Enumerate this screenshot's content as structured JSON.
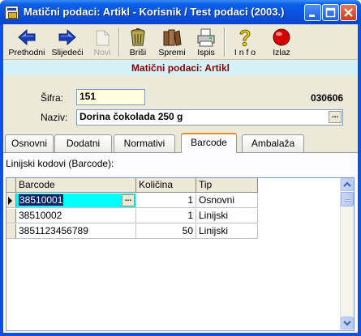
{
  "window": {
    "title": "Matični podaci: Artikl - Korisnik / Test podaci (2003.)"
  },
  "toolbar": {
    "items": [
      {
        "label": "Prethodni",
        "icon": "arrow-left-icon",
        "enabled": true
      },
      {
        "label": "Slijedeći",
        "icon": "arrow-right-icon",
        "enabled": true
      },
      {
        "label": "Novi",
        "icon": "new-document-icon",
        "enabled": false
      },
      {
        "label": "Briši",
        "icon": "trash-bin-icon",
        "enabled": true
      },
      {
        "label": "Spremi",
        "icon": "save-books-icon",
        "enabled": true
      },
      {
        "label": "Ispis",
        "icon": "printer-icon",
        "enabled": true
      },
      {
        "label": "I n f o",
        "icon": "help-question-icon",
        "enabled": true
      },
      {
        "label": "Izlaz",
        "icon": "exit-red-ball-icon",
        "enabled": true
      }
    ]
  },
  "header": {
    "title": "Matični podaci: Artikl"
  },
  "form": {
    "sifra_label": "Šifra:",
    "sifra_value": "151",
    "naziv_label": "Naziv:",
    "naziv_value": "Dorina čokolada 250 g",
    "code": "030606"
  },
  "tabs": [
    {
      "label": "Osnovni",
      "active": false
    },
    {
      "label": "Dodatni",
      "active": false
    },
    {
      "label": "Normativi",
      "active": false
    },
    {
      "label": "Barcode",
      "active": true
    },
    {
      "label": "Ambalaža",
      "active": false
    }
  ],
  "grid": {
    "caption": "Linijski kodovi (Barcode):",
    "columns": [
      "Barcode",
      "Količina",
      "Tip"
    ],
    "rows": [
      {
        "barcode": "38510001",
        "kolicina": "1",
        "tip": "Osnovni"
      },
      {
        "barcode": "38510002",
        "kolicina": "1",
        "tip": "Linijski"
      },
      {
        "barcode": "3851123456789",
        "kolicina": "50",
        "tip": "Linijski"
      }
    ],
    "selected_row": 0
  },
  "colors": {
    "title_bar": "#0a52e0",
    "header_band": "#d4f1f7",
    "header_text": "#8b0000",
    "field_bg": "#ffffe0",
    "selected_cell": "#00ffff",
    "active_tab_accent": "#e68b2c"
  }
}
